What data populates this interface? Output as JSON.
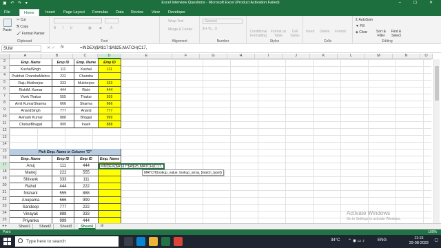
{
  "window": {
    "title": "Excel Interview Questions  -  Microsoft Excel (Product Activation Failed)"
  },
  "ribbon_tabs": [
    "File",
    "Home",
    "Insert",
    "Page Layout",
    "Formulas",
    "Data",
    "Review",
    "View",
    "Developer"
  ],
  "active_tab": "Home",
  "ribbon": {
    "clipboard": {
      "cut": "Cut",
      "copy": "Copy",
      "format_painter": "Format Painter",
      "paste": "Paste",
      "label": "Clipboard"
    },
    "font": {
      "label": "Font"
    },
    "alignment": {
      "wrap_text": "Wrap Text",
      "merge_center": "Merge & Center",
      "label": "Alignment"
    },
    "number": {
      "format": "General",
      "label": "Number"
    },
    "styles": {
      "conditional": "Conditional Formatting",
      "format_table": "Format as Table",
      "cell_styles": "Cell Styles",
      "label": "Styles"
    },
    "cells": {
      "insert": "Insert",
      "delete": "Delete",
      "format": "Format",
      "label": "Cells"
    },
    "editing": {
      "autosum": "AutoSum",
      "fill": "Fill",
      "clear": "Clear",
      "sort_filter": "Sort & Filter",
      "find_select": "Find & Select",
      "label": "Editing"
    }
  },
  "formula_bar": {
    "name_box": "SUM",
    "fx": "fx",
    "formula": "=INDEX($A$17:$A$25,MATCH(C17,"
  },
  "columns": [
    "A",
    "B",
    "C",
    "D",
    "E",
    "F",
    "G",
    "H",
    "I",
    "J",
    "K",
    "L",
    "M",
    "N",
    "O"
  ],
  "rows": [
    2,
    3,
    4,
    5,
    6,
    7,
    8,
    9,
    10,
    11,
    12,
    13,
    14,
    15,
    16,
    17,
    18,
    19,
    20,
    21,
    22,
    23,
    24,
    25
  ],
  "table1": {
    "headers": [
      "Emp. Name",
      "Emp ID",
      "Emp. Name",
      "Emp ID"
    ],
    "rows": [
      [
        "KushalSingh",
        "111",
        "Kushal",
        "111"
      ],
      [
        "Prabhat ChandraMishra",
        "222",
        "Chandra",
        ""
      ],
      [
        "Raju  Mukherjee",
        "333",
        "Mukherjee",
        "333"
      ],
      [
        "RishiM. Kumar",
        "444",
        "Rishi",
        "444"
      ],
      [
        "Vivek Thakur",
        "555",
        "Thakur",
        "555"
      ],
      [
        "Amit KumarSharma",
        "666",
        "Sharma",
        "666"
      ],
      [
        "AnandSingh",
        "777",
        "Anand",
        "777"
      ],
      [
        "Avinash Kumar",
        "888",
        "Bhagat",
        "999"
      ],
      [
        "ChetanBhagat",
        "999",
        "Inash",
        "888"
      ]
    ]
  },
  "table2": {
    "banner": "Pick Emp. Name  in Column \"D\"",
    "headers": [
      "Emp. Name",
      "Emp ID",
      "Emp ID",
      "Emp. Name"
    ],
    "rows": [
      [
        "Anuj",
        "111",
        "444",
        ""
      ],
      [
        "Manoj",
        "222",
        "555",
        ""
      ],
      [
        "Shivank",
        "333",
        "111",
        ""
      ],
      [
        "Rahul",
        "444",
        "222",
        ""
      ],
      [
        "Nishant",
        "555",
        "888",
        ""
      ],
      [
        "Anupama",
        "666",
        "999",
        ""
      ],
      [
        "Sandeep",
        "777",
        "222",
        ""
      ],
      [
        "Vinayak",
        "888",
        "333",
        ""
      ],
      [
        "Priyanka",
        "999",
        "444",
        ""
      ]
    ]
  },
  "active_cell_text": "=INDEX($A$17:$A$25,MATCH(C17,",
  "tooltip": "MATCH(lookup_value, lookup_array, [match_type])",
  "watermark": {
    "line1": "Activate Windows",
    "line2": "Go to Settings to activate Windows."
  },
  "sheets": [
    "Sheet1",
    "Sheet2",
    "Sheet3",
    "Sheet4"
  ],
  "active_sheet": "Sheet4",
  "status": {
    "mode": "Point",
    "zoom": "100%"
  },
  "taskbar": {
    "search_placeholder": "Type here to search",
    "weather": "34°C",
    "language": "ENG",
    "time": "11:15",
    "date": "29-08-2022"
  },
  "colors": {
    "excel_green": "#217346",
    "highlight_yellow": "#ffff00",
    "header_blue": "#b8cce4"
  }
}
